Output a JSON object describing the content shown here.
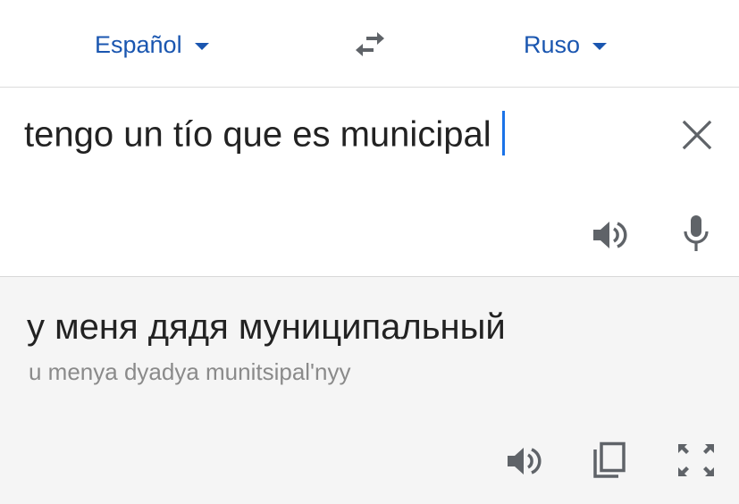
{
  "languages": {
    "source": "Español",
    "target": "Ruso"
  },
  "input": {
    "text": "tengo un tío que es municipal"
  },
  "output": {
    "translation": "у меня дядя муниципальный",
    "transliteration": "u menya dyadya munitsipal'nyy"
  },
  "icons": {
    "swap": "swap-languages-icon",
    "clear": "close-icon",
    "source_audio": "speaker-icon",
    "mic": "microphone-icon",
    "target_audio": "speaker-icon",
    "copy": "copy-icon",
    "fullscreen": "fullscreen-icon"
  },
  "colors": {
    "accent": "#1a56b0",
    "cursor": "#1a73e8",
    "icon": "#5f6368",
    "output_bg": "#f5f5f5"
  }
}
